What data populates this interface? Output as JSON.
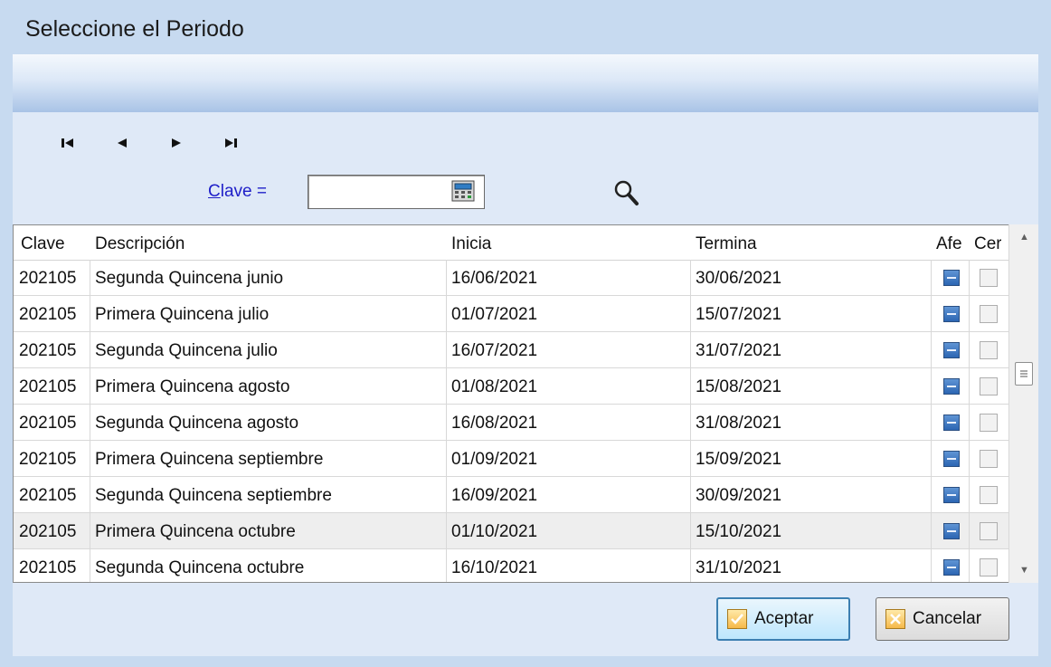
{
  "window": {
    "title": "Seleccione el Periodo"
  },
  "nav": {
    "first_icon": "first-record-icon",
    "prev_icon": "previous-record-icon",
    "next_icon": "next-record-icon",
    "last_icon": "last-record-icon"
  },
  "filter": {
    "label_underlined": "C",
    "label_rest": "lave =",
    "value": "",
    "calc_icon": "calculator-icon",
    "search_icon": "search-icon"
  },
  "grid": {
    "columns": [
      "Clave",
      "Descripción",
      "Inicia",
      "Termina",
      "Afe",
      "Cer"
    ],
    "rows": [
      {
        "clave": "202105",
        "descripcion": "Segunda Quincena junio",
        "inicia": "16/06/2021",
        "termina": "30/06/2021",
        "afe": true,
        "cer": false
      },
      {
        "clave": "202105",
        "descripcion": "Primera Quincena julio",
        "inicia": "01/07/2021",
        "termina": "15/07/2021",
        "afe": true,
        "cer": false
      },
      {
        "clave": "202105",
        "descripcion": "Segunda Quincena julio",
        "inicia": "16/07/2021",
        "termina": "31/07/2021",
        "afe": true,
        "cer": false
      },
      {
        "clave": "202105",
        "descripcion": "Primera Quincena agosto",
        "inicia": "01/08/2021",
        "termina": "15/08/2021",
        "afe": true,
        "cer": false
      },
      {
        "clave": "202105",
        "descripcion": "Segunda Quincena agosto",
        "inicia": "16/08/2021",
        "termina": "31/08/2021",
        "afe": true,
        "cer": false
      },
      {
        "clave": "202105",
        "descripcion": "Primera Quincena septiembre",
        "inicia": "01/09/2021",
        "termina": "15/09/2021",
        "afe": true,
        "cer": false
      },
      {
        "clave": "202105",
        "descripcion": "Segunda Quincena septiembre",
        "inicia": "16/09/2021",
        "termina": "30/09/2021",
        "afe": true,
        "cer": false
      },
      {
        "clave": "202105",
        "descripcion": "Primera Quincena octubre",
        "inicia": "01/10/2021",
        "termina": "15/10/2021",
        "afe": true,
        "cer": false,
        "selected": true
      },
      {
        "clave": "202105",
        "descripcion": "Segunda Quincena octubre",
        "inicia": "16/10/2021",
        "termina": "31/10/2021",
        "afe": true,
        "cer": false
      }
    ]
  },
  "buttons": {
    "accept_label": "Aceptar",
    "cancel_label": "Cancelar"
  },
  "colors": {
    "window_bg": "#c7daf0",
    "client_bg": "#dfe9f7",
    "link_blue": "#1e1ec8",
    "checkbox_blue": "#2c66b3"
  }
}
